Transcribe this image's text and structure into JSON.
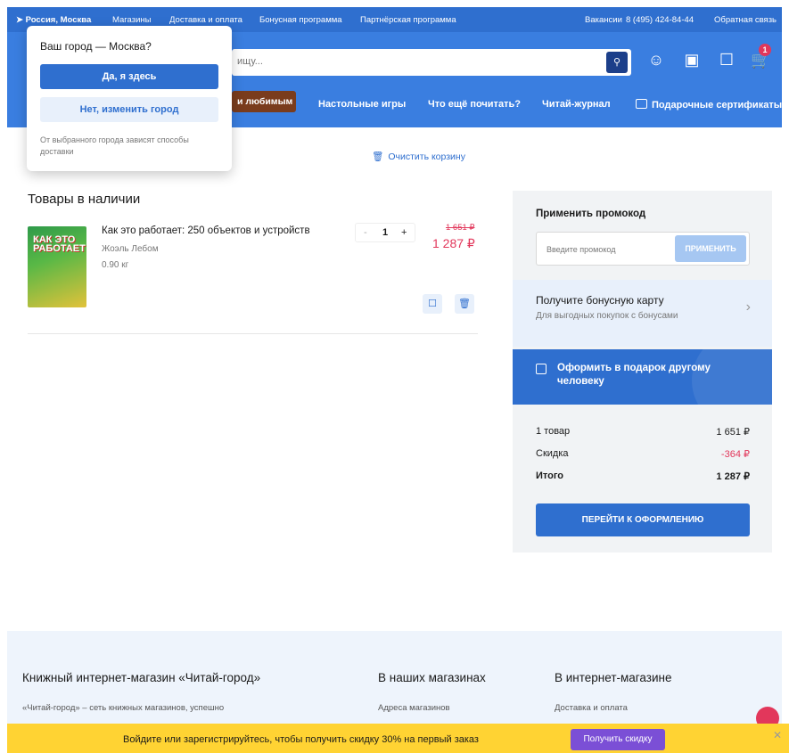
{
  "topbar": {
    "location": "Россия, Москва",
    "links": [
      "Магазины",
      "Доставка и оплата",
      "Бонусная программа",
      "Партнёрская программа"
    ],
    "vacancies": "Вакансии",
    "phone": "8 (495) 424-84-44",
    "feedback": "Обратная связь"
  },
  "header": {
    "search_placeholder": "ищу...",
    "cart_count": "1",
    "nav": [
      "и любимым",
      "Настольные игры",
      "Что ещё почитать?",
      "Читай-журнал",
      "Подарочные сертификаты"
    ]
  },
  "popup": {
    "title": "Ваш город — Москва?",
    "yes": "Да, я здесь",
    "no": "Нет, изменить город",
    "note": "От выбранного города зависят способы доставки"
  },
  "cart": {
    "clear": "Очистить корзину",
    "section_title": "Товары в наличии",
    "item": {
      "title": "Как это работает: 250 объектов и устройств",
      "author": "Жоэль Лебом",
      "weight": "0.90 кг",
      "qty": "1",
      "old_price": "1 651 ₽",
      "new_price": "1 287 ₽",
      "cover_text": "КАК ЭТО РАБОТАЕТ"
    }
  },
  "sidebar": {
    "promo_title": "Применить промокод",
    "promo_placeholder": "Введите промокод",
    "promo_button": "ПРИМЕНИТЬ",
    "bonus_title": "Получите бонусную карту",
    "bonus_sub": "Для выгодных покупок с бонусами",
    "gift": "Оформить в подарок другому человеку",
    "rows": [
      {
        "label": "1 товар",
        "value": "1 651 ₽"
      },
      {
        "label": "Скидка",
        "value": "-364 ₽"
      },
      {
        "label": "Итого",
        "value": "1 287 ₽"
      }
    ],
    "checkout": "ПЕРЕЙТИ К ОФОРМЛЕНИЮ"
  },
  "footer": {
    "col1_title": "Книжный интернет-магазин «Читай-город»",
    "col1_text": "«Читай-город» – сеть книжных магазинов, успешно",
    "col2_title": "В наших магазинах",
    "col2_text": "Адреса магазинов",
    "col3_title": "В интернет-магазине",
    "col3_text": "Доставка и оплата"
  },
  "banner": {
    "text": "Войдите или зарегистрируйтесь, чтобы получить скидку 30% на первый заказ",
    "button": "Получить скидку"
  },
  "colors": {
    "primary": "#2f6fcf",
    "price_red": "#e2375b",
    "banner": "#ffd333",
    "promo_purple": "#7b4fd6"
  }
}
